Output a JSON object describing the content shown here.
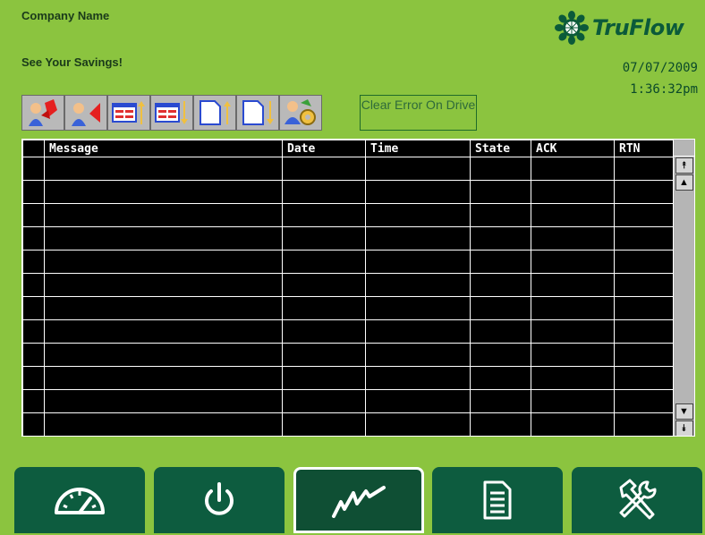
{
  "header": {
    "company": "Company Name",
    "tagline": "See Your Savings!",
    "brand": "TruFlow",
    "date": "07/07/2009",
    "time": "1:36:32pm"
  },
  "toolbar": {
    "buttons": [
      {
        "icon": "acknowledge-alarm-icon"
      },
      {
        "icon": "acknowledge-all-alarms-icon"
      },
      {
        "icon": "sort-ascending-icon"
      },
      {
        "icon": "sort-descending-icon"
      },
      {
        "icon": "page-up-icon"
      },
      {
        "icon": "page-down-icon"
      },
      {
        "icon": "alarm-settings-icon"
      }
    ],
    "clear_error": "Clear Error On Drive"
  },
  "alarm_table": {
    "columns": [
      "",
      "Message",
      "Date",
      "Time",
      "State",
      "ACK",
      "RTN"
    ],
    "row_count": 12,
    "rows": []
  },
  "scrollbar": {
    "top": "⯭",
    "up": "▲",
    "down": "▼",
    "bottom": "⯯"
  },
  "nav": {
    "items": [
      {
        "icon": "gauge-icon",
        "active": false
      },
      {
        "icon": "power-icon",
        "active": false
      },
      {
        "icon": "trend-icon",
        "active": true
      },
      {
        "icon": "document-icon",
        "active": false
      },
      {
        "icon": "tools-icon",
        "active": false
      }
    ]
  },
  "colors": {
    "background": "#8bc43f",
    "nav_green": "#0d5c3f",
    "brand_green": "#0b5a3a",
    "table_bg": "#000000"
  }
}
